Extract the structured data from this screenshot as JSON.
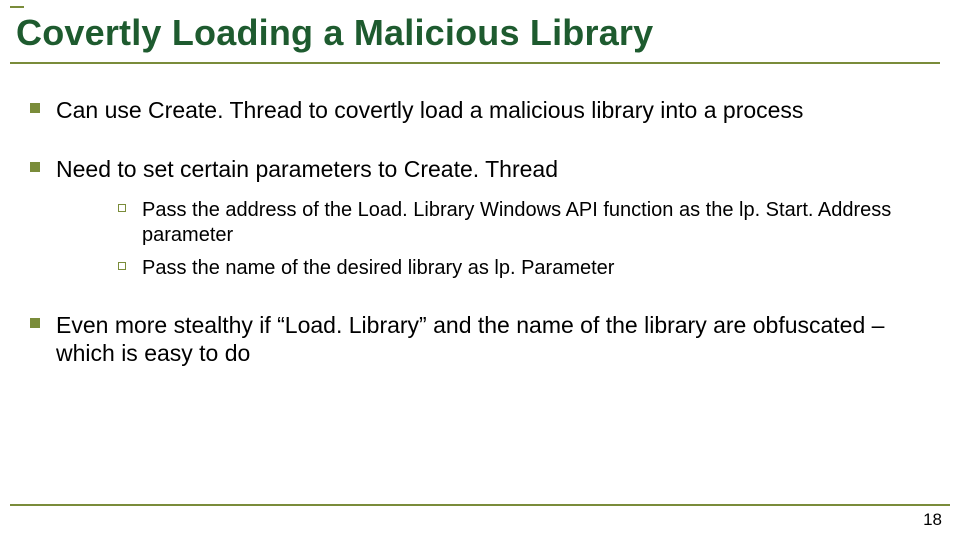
{
  "title": "Covertly Loading a Malicious Library",
  "bullets": {
    "b1": "Can use Create. Thread to covertly load a malicious library into a process",
    "b2": "Need to set certain parameters to Create. Thread",
    "b2_sub1": "Pass the address of the Load. Library Windows API function as the lp. Start. Address parameter",
    "b2_sub2": "Pass the name of the desired library as lp. Parameter",
    "b3": "Even more stealthy if “Load. Library” and the name of the library are obfuscated – which is easy to do"
  },
  "page_number": "18"
}
